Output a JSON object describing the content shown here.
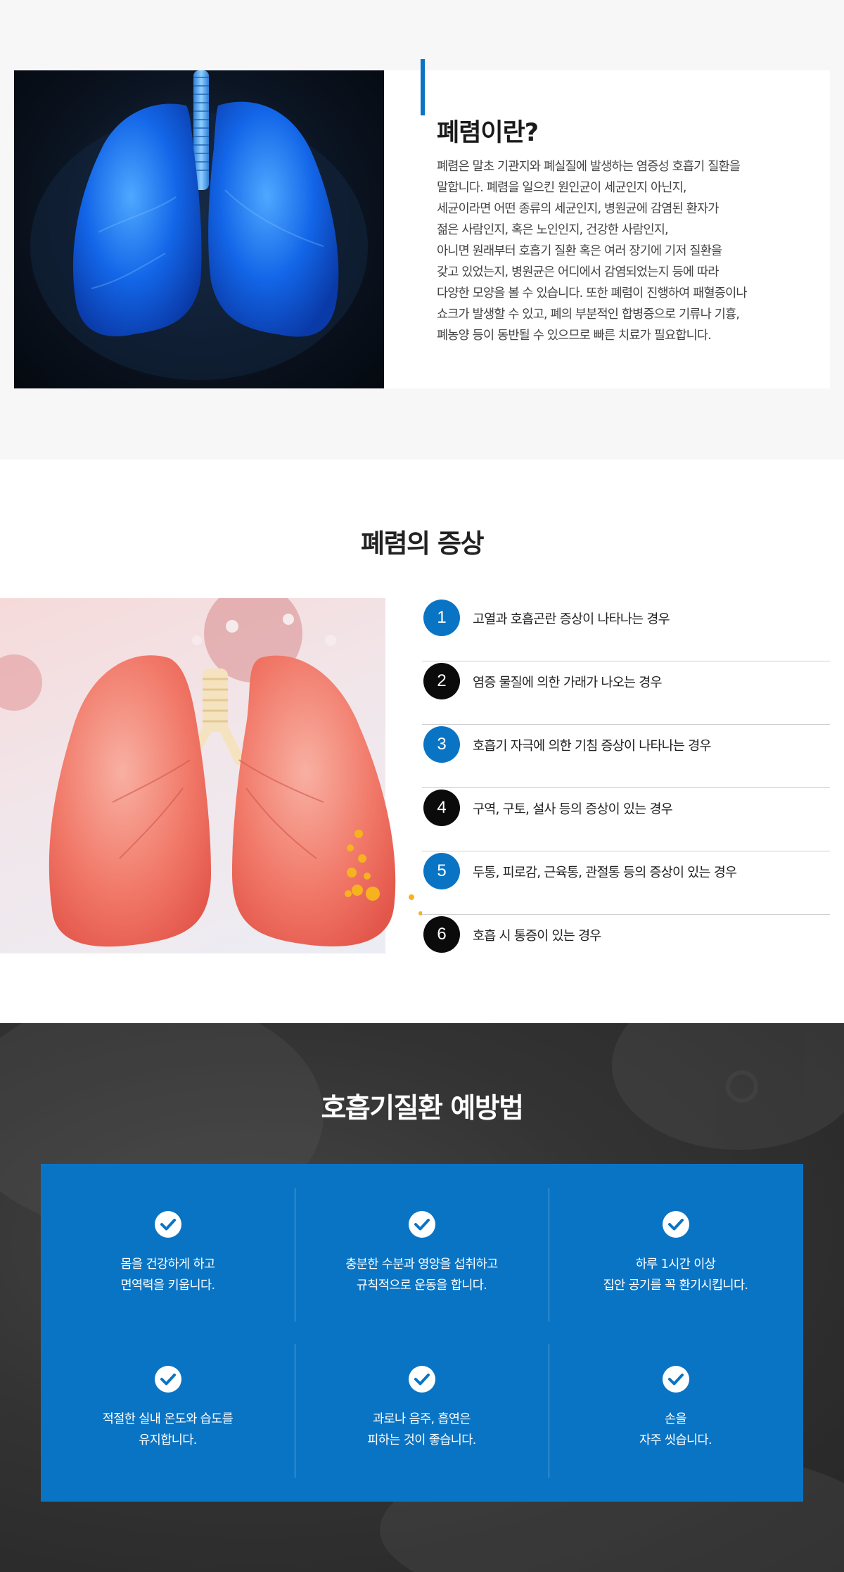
{
  "intro": {
    "title": "폐렴이란?",
    "lines": [
      "폐렴은 말초 기관지와 폐실질에 발생하는 염증성 호흡기 질환을",
      "말합니다. 폐렴을 일으킨 원인균이 세균인지 아닌지,",
      "세균이라면 어떤 종류의 세균인지, 병원균에 감염된 환자가",
      "젊은 사람인지, 혹은 노인인지, 건강한 사람인지,",
      "아니면 원래부터 호흡기 질환 혹은 여러 장기에 기저 질환을",
      "갖고 있었는지, 병원균은 어디에서 감염되었는지 등에 따라",
      "다양한 모양을 볼 수 있습니다. 또한 폐렴이 진행하여 패혈증이나",
      "쇼크가 발생할 수 있고, 폐의 부분적인 합병증으로 기류나 기흉,",
      "폐농양 등이 동반될 수 있으므로 빠른 치료가 필요합니다."
    ],
    "accent_color": "#0a74c4"
  },
  "symptoms": {
    "title_normal": "폐렴의 ",
    "title_bold": "증상",
    "items": [
      {
        "num": "1",
        "text": "고열과 호흡곤란 증상이 나타나는 경우",
        "color": "blue"
      },
      {
        "num": "2",
        "text": "염증 물질에 의한 가래가 나오는 경우",
        "color": "black"
      },
      {
        "num": "3",
        "text": "호흡기 자극에 의한 기침 증상이 나타나는 경우",
        "color": "blue"
      },
      {
        "num": "4",
        "text": "구역, 구토, 설사 등의 증상이 있는 경우",
        "color": "black"
      },
      {
        "num": "5",
        "text": "두통, 피로감, 근육통, 관절통 등의 증상이 있는 경우",
        "color": "blue"
      },
      {
        "num": "6",
        "text": "호흡 시 통증이 있는 경우",
        "color": "black"
      }
    ]
  },
  "prevention": {
    "title_normal": "호흡기질환 ",
    "title_bold": "예방법",
    "box_color": "#0a74c4",
    "items": [
      {
        "icon": "check-circle-icon",
        "lines": [
          "몸을 건강하게 하고",
          "면역력을 키웁니다."
        ]
      },
      {
        "icon": "check-circle-icon",
        "lines": [
          "충분한 수분과 영양을 섭취하고",
          "규칙적으로 운동을 합니다."
        ]
      },
      {
        "icon": "check-circle-icon",
        "lines": [
          "하루 1시간 이상",
          "집안 공기를 꼭 환기시킵니다."
        ]
      },
      {
        "icon": "check-circle-icon",
        "lines": [
          "적절한 실내 온도와 습도를",
          "유지합니다."
        ]
      },
      {
        "icon": "check-circle-icon",
        "lines": [
          "과로나 음주, 흡연은",
          "피하는 것이 좋습니다."
        ]
      },
      {
        "icon": "check-circle-icon",
        "lines": [
          "손을",
          "자주 씻습니다."
        ]
      }
    ]
  }
}
